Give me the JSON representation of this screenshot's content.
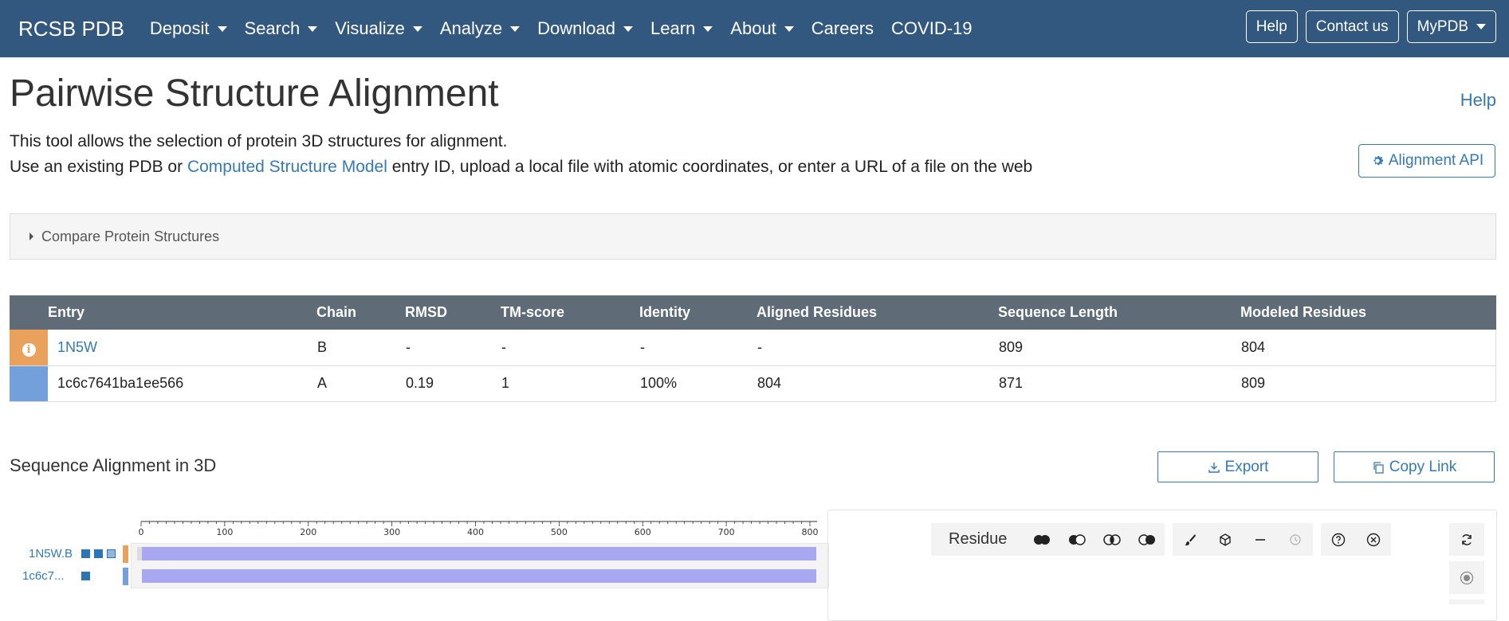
{
  "navbar": {
    "brand": "RCSB PDB",
    "menu": [
      {
        "label": "Deposit",
        "dropdown": true
      },
      {
        "label": "Search",
        "dropdown": true
      },
      {
        "label": "Visualize",
        "dropdown": true
      },
      {
        "label": "Analyze",
        "dropdown": true
      },
      {
        "label": "Download",
        "dropdown": true
      },
      {
        "label": "Learn",
        "dropdown": true
      },
      {
        "label": "About",
        "dropdown": true
      },
      {
        "label": "Careers",
        "dropdown": false
      },
      {
        "label": "COVID-19",
        "dropdown": false
      }
    ],
    "help": "Help",
    "contact": "Contact us",
    "mypdb": "MyPDB",
    "bg_color": "#325880"
  },
  "header": {
    "title": "Pairwise Structure Alignment",
    "help": "Help",
    "intro_line1": "This tool allows the selection of protein 3D structures for alignment.",
    "intro_line2_pre": "Use an existing PDB or ",
    "intro_line2_link": "Computed Structure Model",
    "intro_line2_post": " entry ID, upload a local file with atomic coordinates, or enter a URL of a file on the web",
    "api_button": "Alignment API"
  },
  "compare": {
    "label": "Compare Protein Structures"
  },
  "results": {
    "columns": [
      "Entry",
      "Chain",
      "RMSD",
      "TM-score",
      "Identity",
      "Aligned Residues",
      "Sequence Length",
      "Modeled Residues"
    ],
    "rows": [
      {
        "entry": "1N5W",
        "chain": "B",
        "rmsd": "-",
        "tm": "-",
        "identity": "-",
        "aligned": "-",
        "seqlen": "809",
        "modeled": "804",
        "color": "#e9a15b",
        "link": true
      },
      {
        "entry": "1c6c7641ba1ee566",
        "chain": "A",
        "rmsd": "0.19",
        "tm": "1",
        "identity": "100%",
        "aligned": "804",
        "seqlen": "871",
        "modeled": "809",
        "color": "#739fdb",
        "link": false
      }
    ]
  },
  "sequence": {
    "title": "Sequence Alignment in 3D",
    "export": "Export",
    "copy_link": "Copy Link",
    "ruler_ticks": [
      "0",
      "100",
      "200",
      "300",
      "400",
      "500",
      "600",
      "700",
      "800"
    ],
    "tracks": [
      {
        "label": "1N5W.B"
      },
      {
        "label": "1c6c7..."
      }
    ]
  },
  "viewer": {
    "mode_label": "Residue"
  }
}
